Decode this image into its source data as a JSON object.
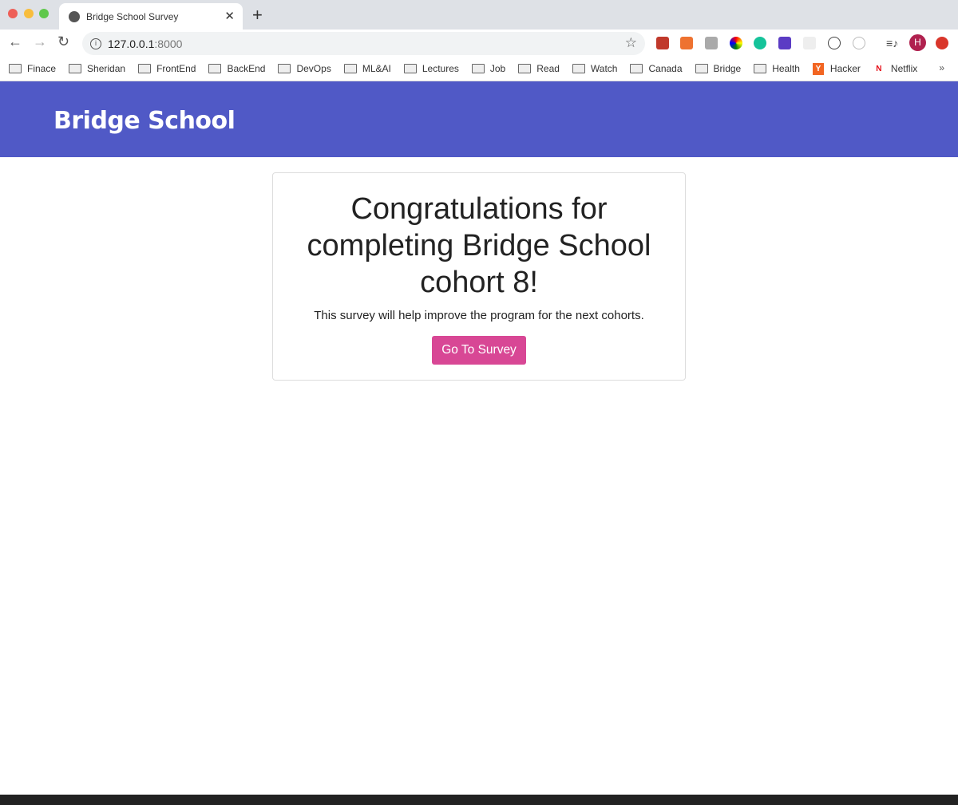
{
  "browser": {
    "tab_title": "Bridge School Survey",
    "url_host": "127.0.0.1",
    "url_port": ":8000",
    "profile_initial": "H",
    "bookmarks": [
      {
        "label": "Finace",
        "icon": "folder-icon"
      },
      {
        "label": "Sheridan",
        "icon": "folder-icon"
      },
      {
        "label": "FrontEnd",
        "icon": "folder-icon"
      },
      {
        "label": "BackEnd",
        "icon": "folder-icon"
      },
      {
        "label": "DevOps",
        "icon": "folder-icon"
      },
      {
        "label": "ML&AI",
        "icon": "folder-icon"
      },
      {
        "label": "Lectures",
        "icon": "folder-icon"
      },
      {
        "label": "Job",
        "icon": "folder-icon"
      },
      {
        "label": "Read",
        "icon": "folder-icon"
      },
      {
        "label": "Watch",
        "icon": "folder-icon"
      },
      {
        "label": "Canada",
        "icon": "folder-icon"
      },
      {
        "label": "Bridge",
        "icon": "folder-icon"
      },
      {
        "label": "Health",
        "icon": "folder-icon"
      },
      {
        "label": "Hacker",
        "icon": "hacker-news-icon",
        "badge": "Y"
      },
      {
        "label": "Netflix",
        "icon": "netflix-icon",
        "badge": "N"
      }
    ],
    "more": "»"
  },
  "header": {
    "brand": "Bridge School",
    "color": "#5059c6"
  },
  "card": {
    "title": "Congratulations for completing Bridge School cohort 8!",
    "subtitle": "This survey will help improve the program for the next cohorts.",
    "button": "Go To Survey",
    "button_color": "#d84795"
  }
}
